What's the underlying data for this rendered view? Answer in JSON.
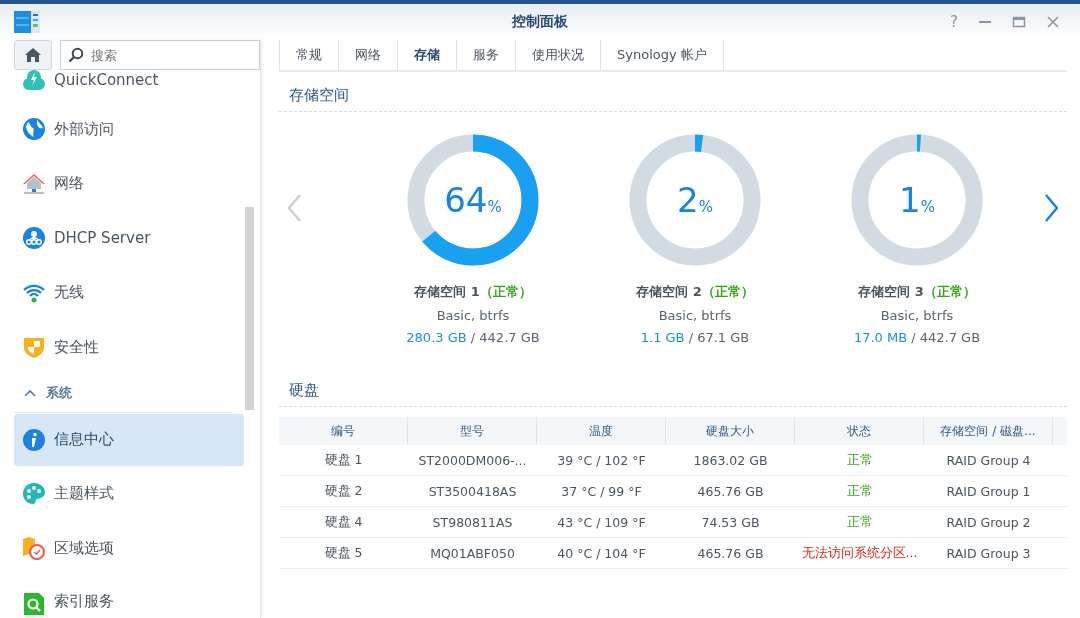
{
  "window": {
    "title": "控制面板",
    "controls": [
      "?"
    ]
  },
  "sidebar": {
    "search": {
      "placeholder": "搜索"
    },
    "items": [
      {
        "label": "QuickConnect",
        "selected": false
      },
      {
        "label": "外部访问",
        "selected": false
      },
      {
        "label": "网络",
        "selected": false
      },
      {
        "label": "DHCP Server",
        "selected": false
      },
      {
        "label": "无线",
        "selected": false
      },
      {
        "label": "安全性",
        "selected": false
      },
      {
        "kind": "section",
        "label": "系统",
        "expanded": true
      },
      {
        "label": "信息中心",
        "selected": true
      },
      {
        "label": "主题样式",
        "selected": false
      },
      {
        "label": "区域选项",
        "selected": false
      },
      {
        "label": "索引服务",
        "selected": false
      }
    ]
  },
  "tabs": [
    {
      "label": "常规",
      "selected": false
    },
    {
      "label": "网络",
      "selected": false
    },
    {
      "label": "存储",
      "selected": true
    },
    {
      "label": "服务",
      "selected": false
    },
    {
      "label": "使用状况",
      "selected": false
    },
    {
      "label": "Synology 帐户",
      "selected": false
    }
  ],
  "storage": {
    "title": "存储空间",
    "volumes": [
      {
        "percent": "64",
        "unit": "%",
        "level": 0.64,
        "name": "存储空间 1",
        "status": "（正常）",
        "type": "Basic, btrfs",
        "used": "280.3 GB",
        "total": "/ 442.7 GB"
      },
      {
        "percent": "2",
        "unit": "%",
        "level": 0.02,
        "name": "存储空间 2",
        "status": "（正常）",
        "type": "Basic, btrfs",
        "used": "1.1 GB",
        "total": "/ 67.1 GB"
      },
      {
        "percent": "1",
        "unit": "%",
        "level": 0.01,
        "name": "存储空间 3",
        "status": "（正常）",
        "type": "Basic, btrfs",
        "used": "17.0 MB",
        "total": "/ 442.7 GB"
      }
    ],
    "prev_disabled": true
  },
  "disks": {
    "title": "硬盘",
    "columns": [
      "编号",
      "型号",
      "温度",
      "硬盘大小",
      "状态",
      "存储空间 / 磁盘..."
    ],
    "rows": [
      {
        "cells": [
          "硬盘 1",
          "ST2000DM006-...",
          "39 °C / 102 °F",
          "1863.02 GB",
          "正常",
          "RAID Group 4"
        ],
        "kind": "normal"
      },
      {
        "cells": [
          "硬盘 2",
          "ST3500418AS",
          "37 °C / 99 °F",
          "465.76 GB",
          "正常",
          "RAID Group 1"
        ],
        "kind": "normal"
      },
      {
        "cells": [
          "硬盘 4",
          "ST980811AS",
          "43 °C / 109 °F",
          "74.53 GB",
          "正常",
          "RAID Group 2"
        ],
        "kind": "normal"
      },
      {
        "cells": [
          "硬盘 5",
          "MQ01ABF050",
          "40 °C / 104 °F",
          "465.76 GB",
          "无法访问系统分区...",
          "RAID Group 3"
        ],
        "kind": "error"
      }
    ]
  }
}
